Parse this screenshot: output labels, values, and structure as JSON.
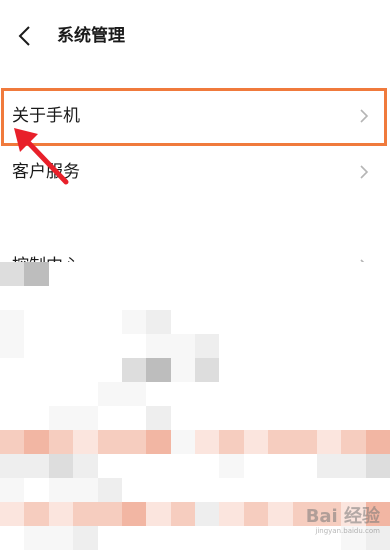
{
  "header": {
    "title": "系统管理",
    "back_icon": "chevron-left-icon"
  },
  "settings_items": [
    {
      "label": "关于手机",
      "icon": "chevron-right-icon"
    },
    {
      "label": "客户服务",
      "icon": "chevron-right-icon"
    },
    {
      "label": "控制中心",
      "icon": "chevron-right-icon"
    }
  ],
  "colors": {
    "highlight_border": "#f07a3c",
    "annotation_arrow": "#e8202a",
    "chevron": "#b5b5b5"
  },
  "watermark": {
    "brand": "Bai 经验",
    "url": "jingyan.baidu.com"
  }
}
